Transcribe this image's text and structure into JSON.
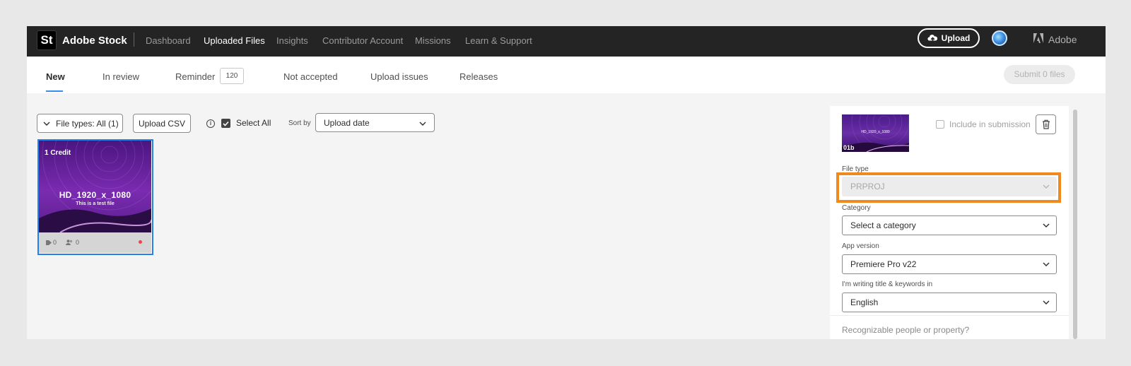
{
  "topbar": {
    "logo_text": "St",
    "brand": "Adobe Stock",
    "nav": [
      "Dashboard",
      "Uploaded Files",
      "Insights",
      "Contributor Account",
      "Missions",
      "Learn & Support"
    ],
    "active_nav": "Uploaded Files",
    "upload_label": "Upload",
    "adobe_label": "Adobe"
  },
  "tabs": {
    "items": [
      "New",
      "In review",
      "Reminder",
      "Not accepted",
      "Upload issues",
      "Releases"
    ],
    "active": "New",
    "reminder_count": "120",
    "submit_label": "Submit 0 files"
  },
  "toolbar": {
    "file_types_label": "File types: All (1)",
    "upload_csv_label": "Upload CSV",
    "select_all_label": "Select All",
    "select_all_checked": true,
    "sort_by_label": "Sort by",
    "sort_value": "Upload date"
  },
  "card": {
    "credit": "1 Credit",
    "title": "HD_1920_x_1080",
    "subtitle": "This is a test file",
    "keywords_count": "0",
    "people_count": "0"
  },
  "panel": {
    "thumb_label": "01b",
    "thumb_text": "HD_1920_x_1080",
    "include_label": "Include in submission",
    "include_checked": false,
    "fields": [
      {
        "label": "File type",
        "value": "PRPROJ",
        "disabled": true
      },
      {
        "label": "Category",
        "value": "Select a category",
        "disabled": false
      },
      {
        "label": "App version",
        "value": "Premiere Pro v22",
        "disabled": false
      },
      {
        "label": "I'm writing title & keywords in",
        "value": "English",
        "disabled": false
      }
    ],
    "cutoff_label": "Recognizable people or property?"
  },
  "colors": {
    "accent": "#2680eb",
    "highlight": "#ef8a1e",
    "topbar": "#242424"
  }
}
